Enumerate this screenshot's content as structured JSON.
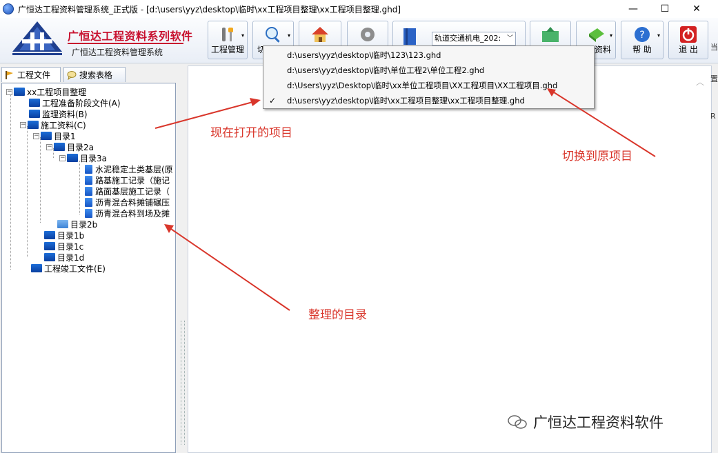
{
  "window": {
    "title": "广恒达工程资料管理系统_正式版 - [d:\\users\\yyz\\desktop\\临时\\xx工程项目整理\\xx工程项目整理.ghd]",
    "minimize": "—",
    "maximize": "☐",
    "close": "✕"
  },
  "brand": {
    "title": "广恒达工程资料系列软件",
    "subtitle": "广恒达工程资料管理系统"
  },
  "toolbar": {
    "project_mgmt_label": "工程管理",
    "switch_label": "切",
    "data_label": "资料",
    "help_label": "帮 助",
    "exit_label": "退 出",
    "combo_value": "轨道交通机电_202:",
    "combo_arrow": "﹀"
  },
  "tabs": {
    "project_files": "工程文件",
    "search_forms": "搜索表格"
  },
  "tree": {
    "root": "xx工程项目整理",
    "n1": "工程准备阶段文件(A)",
    "n2": "监理资料(B)",
    "n3": "施工资料(C)",
    "n3_1": "目录1",
    "n3_1_a": "目录2a",
    "n3_1_a_a": "目录3a",
    "d1": "水泥稳定土类基层(原",
    "d2": "路基施工记录（施记",
    "d3": "路面基层施工记录（",
    "d4": "沥青混合料摊铺碾压",
    "d5": "沥青混合料到场及摊",
    "n3_1_b": "目录2b",
    "n3_b": "目录1b",
    "n3_c": "目录1c",
    "n3_d": "目录1d",
    "n4": "工程竣工文件(E)"
  },
  "menu": {
    "items": [
      {
        "path": "d:\\users\\yyz\\desktop\\临时\\123\\123.ghd",
        "checked": ""
      },
      {
        "path": "d:\\users\\yyz\\desktop\\临时\\单位工程2\\单位工程2.ghd",
        "checked": ""
      },
      {
        "path": "d:\\Users\\yyz\\Desktop\\临时\\xx单位工程项目\\XX工程项目\\XX工程项目.ghd",
        "checked": ""
      },
      {
        "path": "d:\\users\\yyz\\desktop\\临时\\xx工程项目整理\\xx工程项目整理.ghd",
        "checked": "✓"
      }
    ]
  },
  "annotations": {
    "current_project": "现在打开的项目",
    "switch_back": "切换到原项目",
    "organized_dir": "整理的目录"
  },
  "watermark": {
    "text": "广恒达工程资料软件"
  },
  "right_edge": {
    "g1": "当",
    "g2": "置",
    "g3": "R"
  },
  "colors": {
    "annotation": "#d9362b",
    "brand_red": "#c8102e",
    "folder_blue": "#0b3fa0"
  }
}
